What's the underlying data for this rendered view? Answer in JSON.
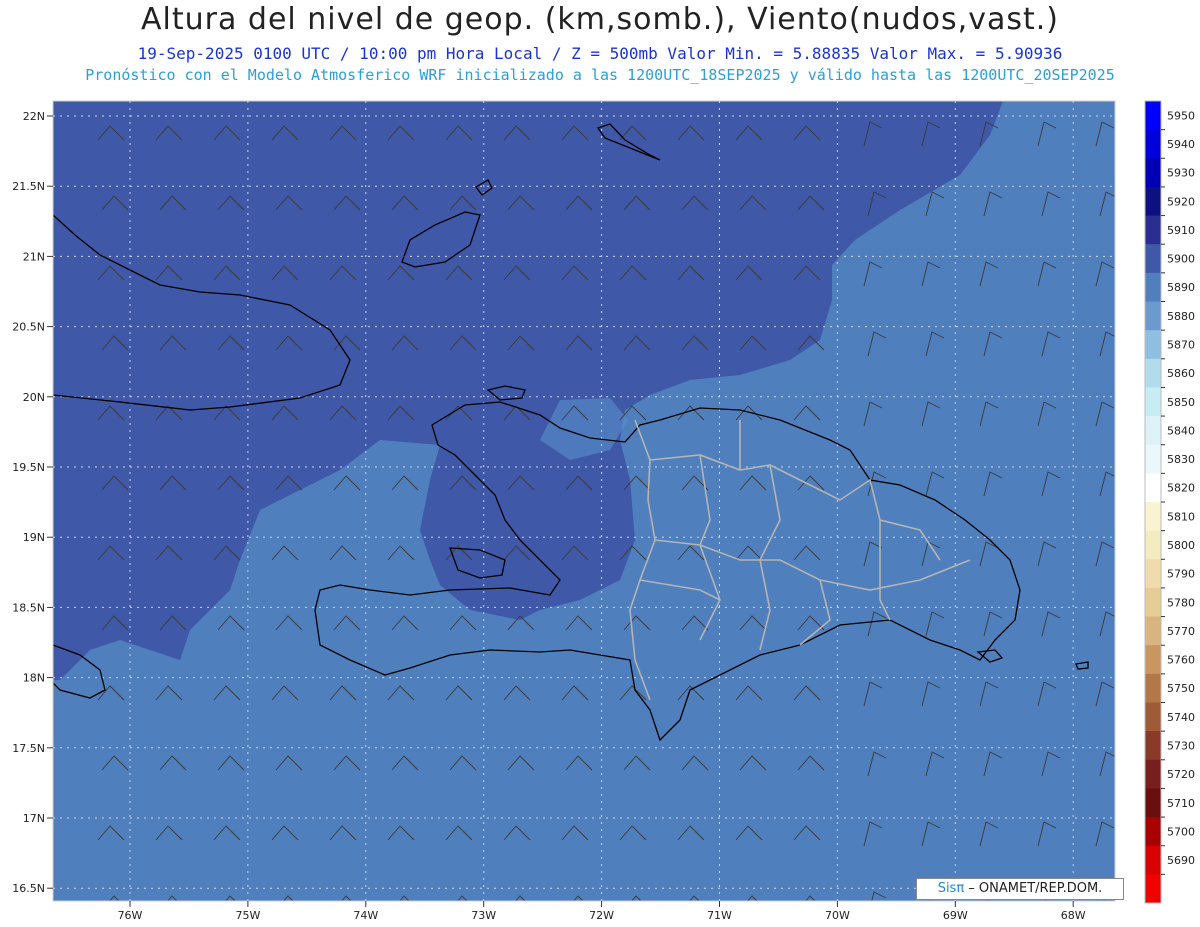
{
  "header": {
    "title": "Altura del nivel de geop. (km,somb.), Viento(nudos,vast.)",
    "subtitle": "19-Sep-2025 0100 UTC / 10:00 pm Hora Local / Z = 500mb   Valor Min. = 5.88835  Valor Max. = 5.90936",
    "model_line": "Pronóstico con el Modelo Atmosferico WRF inicializado a las 1200UTC_18SEP2025 y válido hasta las  1200UTC_20SEP2025"
  },
  "map": {
    "lat_labels": [
      "22N",
      "21.5N",
      "21N",
      "20.5N",
      "20N",
      "19.5N",
      "19N",
      "18.5N",
      "18N",
      "17.5N",
      "17N",
      "16.5N"
    ],
    "lon_labels": [
      "76W",
      "75W",
      "74W",
      "73W",
      "72W",
      "71W",
      "70W",
      "69W",
      "68W"
    ],
    "colors": {
      "dark_band": "#3f58a8",
      "mid_band": "#4f7fbd",
      "light_patch": "#5a8fcb",
      "coast": "#000000",
      "border": "#b4b4b4",
      "grid": "#d0d6e8"
    }
  },
  "colorbar": {
    "levels": [
      "5950",
      "5940",
      "5930",
      "5920",
      "5910",
      "5900",
      "5890",
      "5880",
      "5870",
      "5860",
      "5850",
      "5840",
      "5830",
      "5820",
      "5810",
      "5800",
      "5790",
      "5780",
      "5770",
      "5760",
      "5750",
      "5740",
      "5730",
      "5720",
      "5710",
      "5700",
      "5690"
    ],
    "colors": [
      "#0000ff",
      "#0000dc",
      "#0000b4",
      "#0c1080",
      "#2a2e90",
      "#3f58a8",
      "#4f7fbd",
      "#6a9ad0",
      "#8ebee0",
      "#b0dcec",
      "#c8ecf4",
      "#ddf3f8",
      "#eaf8fb",
      "#ffffff",
      "#faf3d2",
      "#f5ebc0",
      "#efdcaa",
      "#e6cc95",
      "#d9b47e",
      "#c99660",
      "#b47848",
      "#a05a36",
      "#8a3a28",
      "#781e1e",
      "#6a0e0e",
      "#a80000",
      "#d80000",
      "#f00000"
    ]
  },
  "credit": {
    "brand": "Sisπ",
    "text": " – ONAMET/REP.DOM."
  }
}
